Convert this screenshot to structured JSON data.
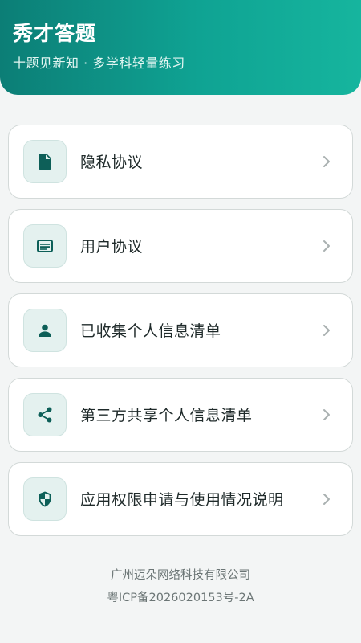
{
  "header": {
    "title": "秀才答题",
    "subtitle": "十题见新知 · 多学科轻量练习"
  },
  "menu": {
    "items": [
      {
        "label": "隐私协议",
        "icon": "document-icon"
      },
      {
        "label": "用户协议",
        "icon": "card-text-icon"
      },
      {
        "label": "已收集个人信息清单",
        "icon": "person-icon"
      },
      {
        "label": "第三方共享个人信息清单",
        "icon": "share-icon"
      },
      {
        "label": "应用权限申请与使用情况说明",
        "icon": "shield-icon"
      }
    ]
  },
  "footer": {
    "company": "广州迈朵网络科技有限公司",
    "icp": "粤ICP备2026020153号-2A"
  },
  "colors": {
    "header_gradient_start": "#0c7e76",
    "header_gradient_end": "#16b59e",
    "icon_color": "#0d5f58",
    "icon_bg": "#e4f1ef",
    "background": "#f3f5f5"
  }
}
